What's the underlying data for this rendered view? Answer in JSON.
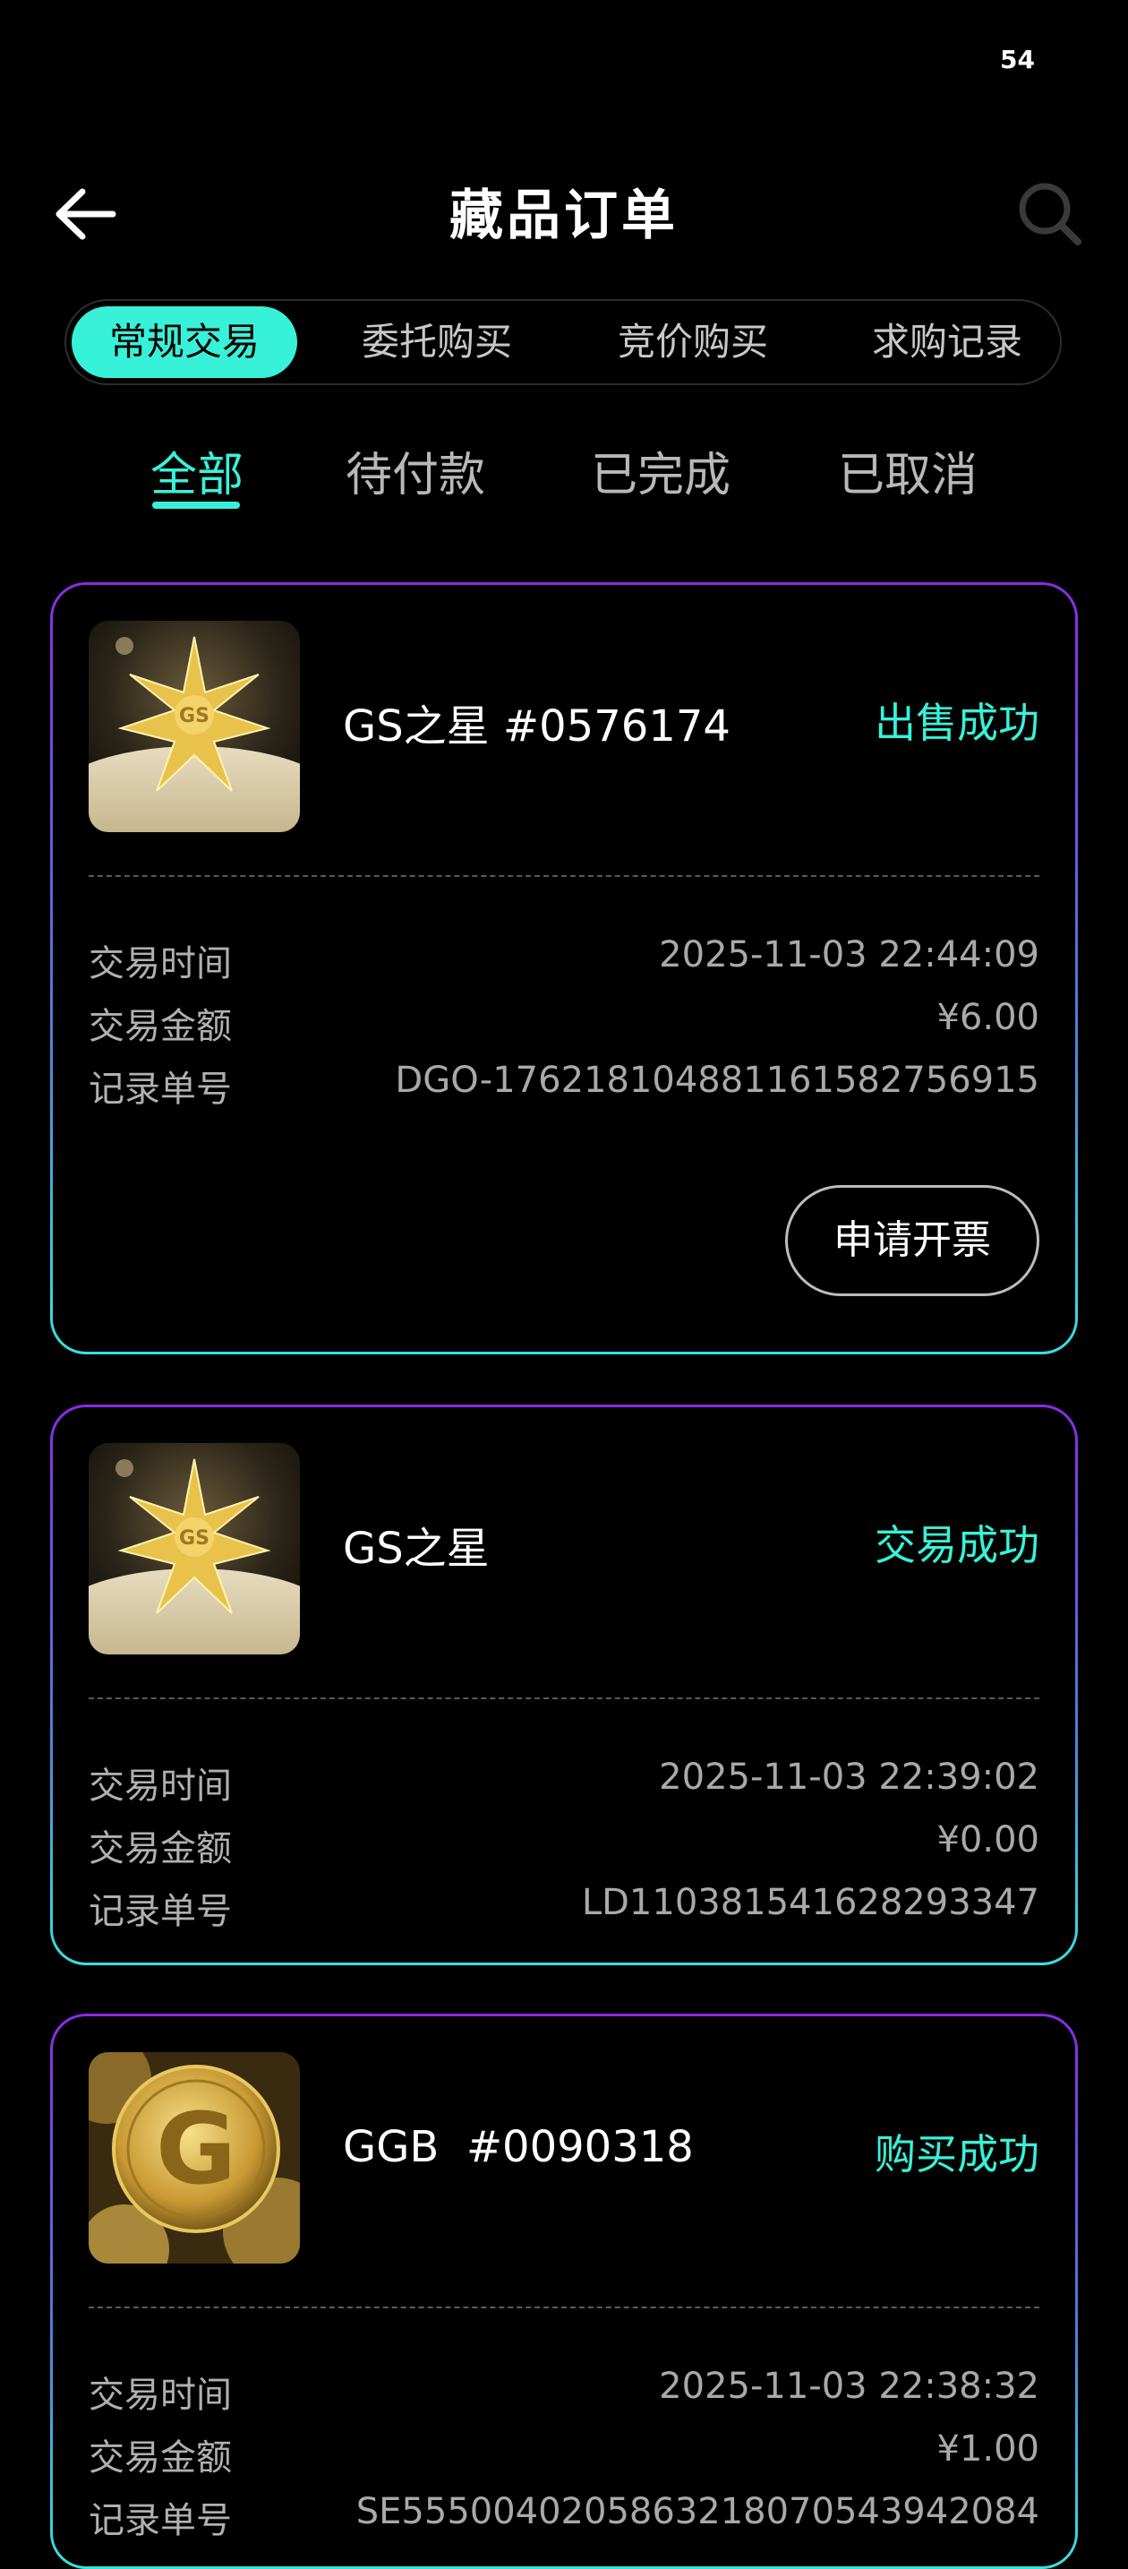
{
  "status_bar": {
    "battery": "54"
  },
  "header": {
    "title": "藏品订单"
  },
  "segments": [
    {
      "label": "常规交易",
      "active": true
    },
    {
      "label": "委托购买",
      "active": false
    },
    {
      "label": "竞价购买",
      "active": false
    },
    {
      "label": "求购记录",
      "active": false
    }
  ],
  "subtabs": [
    {
      "label": "全部",
      "active": true
    },
    {
      "label": "待付款",
      "active": false
    },
    {
      "label": "已完成",
      "active": false
    },
    {
      "label": "已取消",
      "active": false
    }
  ],
  "field_labels": {
    "time": "交易时间",
    "amount": "交易金额",
    "record": "记录单号"
  },
  "orders": [
    {
      "name": "GS之星 #0576174",
      "status": "出售成功",
      "time": "2025-11-03 22:44:09",
      "amount": "¥6.00",
      "record": "DGO-1762181048811615827569​15",
      "image_text": "GS",
      "button": "申请开票"
    },
    {
      "name": "GS之星",
      "status": "交易成功",
      "time": "2025-11-03 22:39:02",
      "amount": "¥0.00",
      "record": "LD110381541628293347",
      "image_text": "GS"
    },
    {
      "name": "GGB  #0090318",
      "status": "购买成功",
      "time": "2025-11-03 22:38:32",
      "amount": "¥1.00",
      "record": "SE5550040205863218070543942084",
      "image_text": "G"
    }
  ],
  "colors": {
    "accent": "#37f2d8",
    "border_top": "#8a2be2",
    "border_bottom": "#37e0e0"
  }
}
